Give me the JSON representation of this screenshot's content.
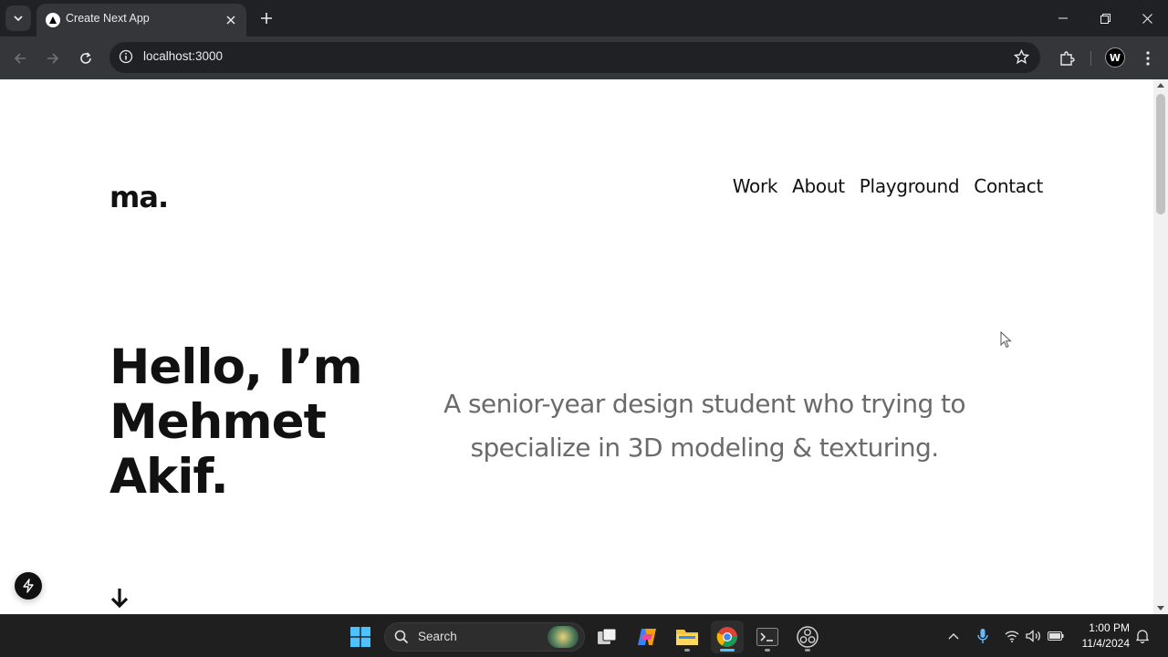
{
  "browser": {
    "tab_title": "Create Next App",
    "url": "localhost:3000",
    "profile_initial": "W"
  },
  "site": {
    "logo": "ma.",
    "nav": [
      "Work",
      "About",
      "Playground",
      "Contact"
    ],
    "hero_title": "Hello, I’m Mehmet Akif.",
    "hero_subtitle": "A senior-year design student who trying to specialize in 3D modeling & texturing."
  },
  "taskbar": {
    "search_label": "Search",
    "time": "1:00 PM",
    "date": "11/4/2024"
  },
  "icons": {
    "tab_search": "chevron-down-icon",
    "tab_favicon": "nextjs-triangle-icon",
    "dev_badge": "lightning-icon",
    "scroll_hint": "arrow-down-icon"
  }
}
